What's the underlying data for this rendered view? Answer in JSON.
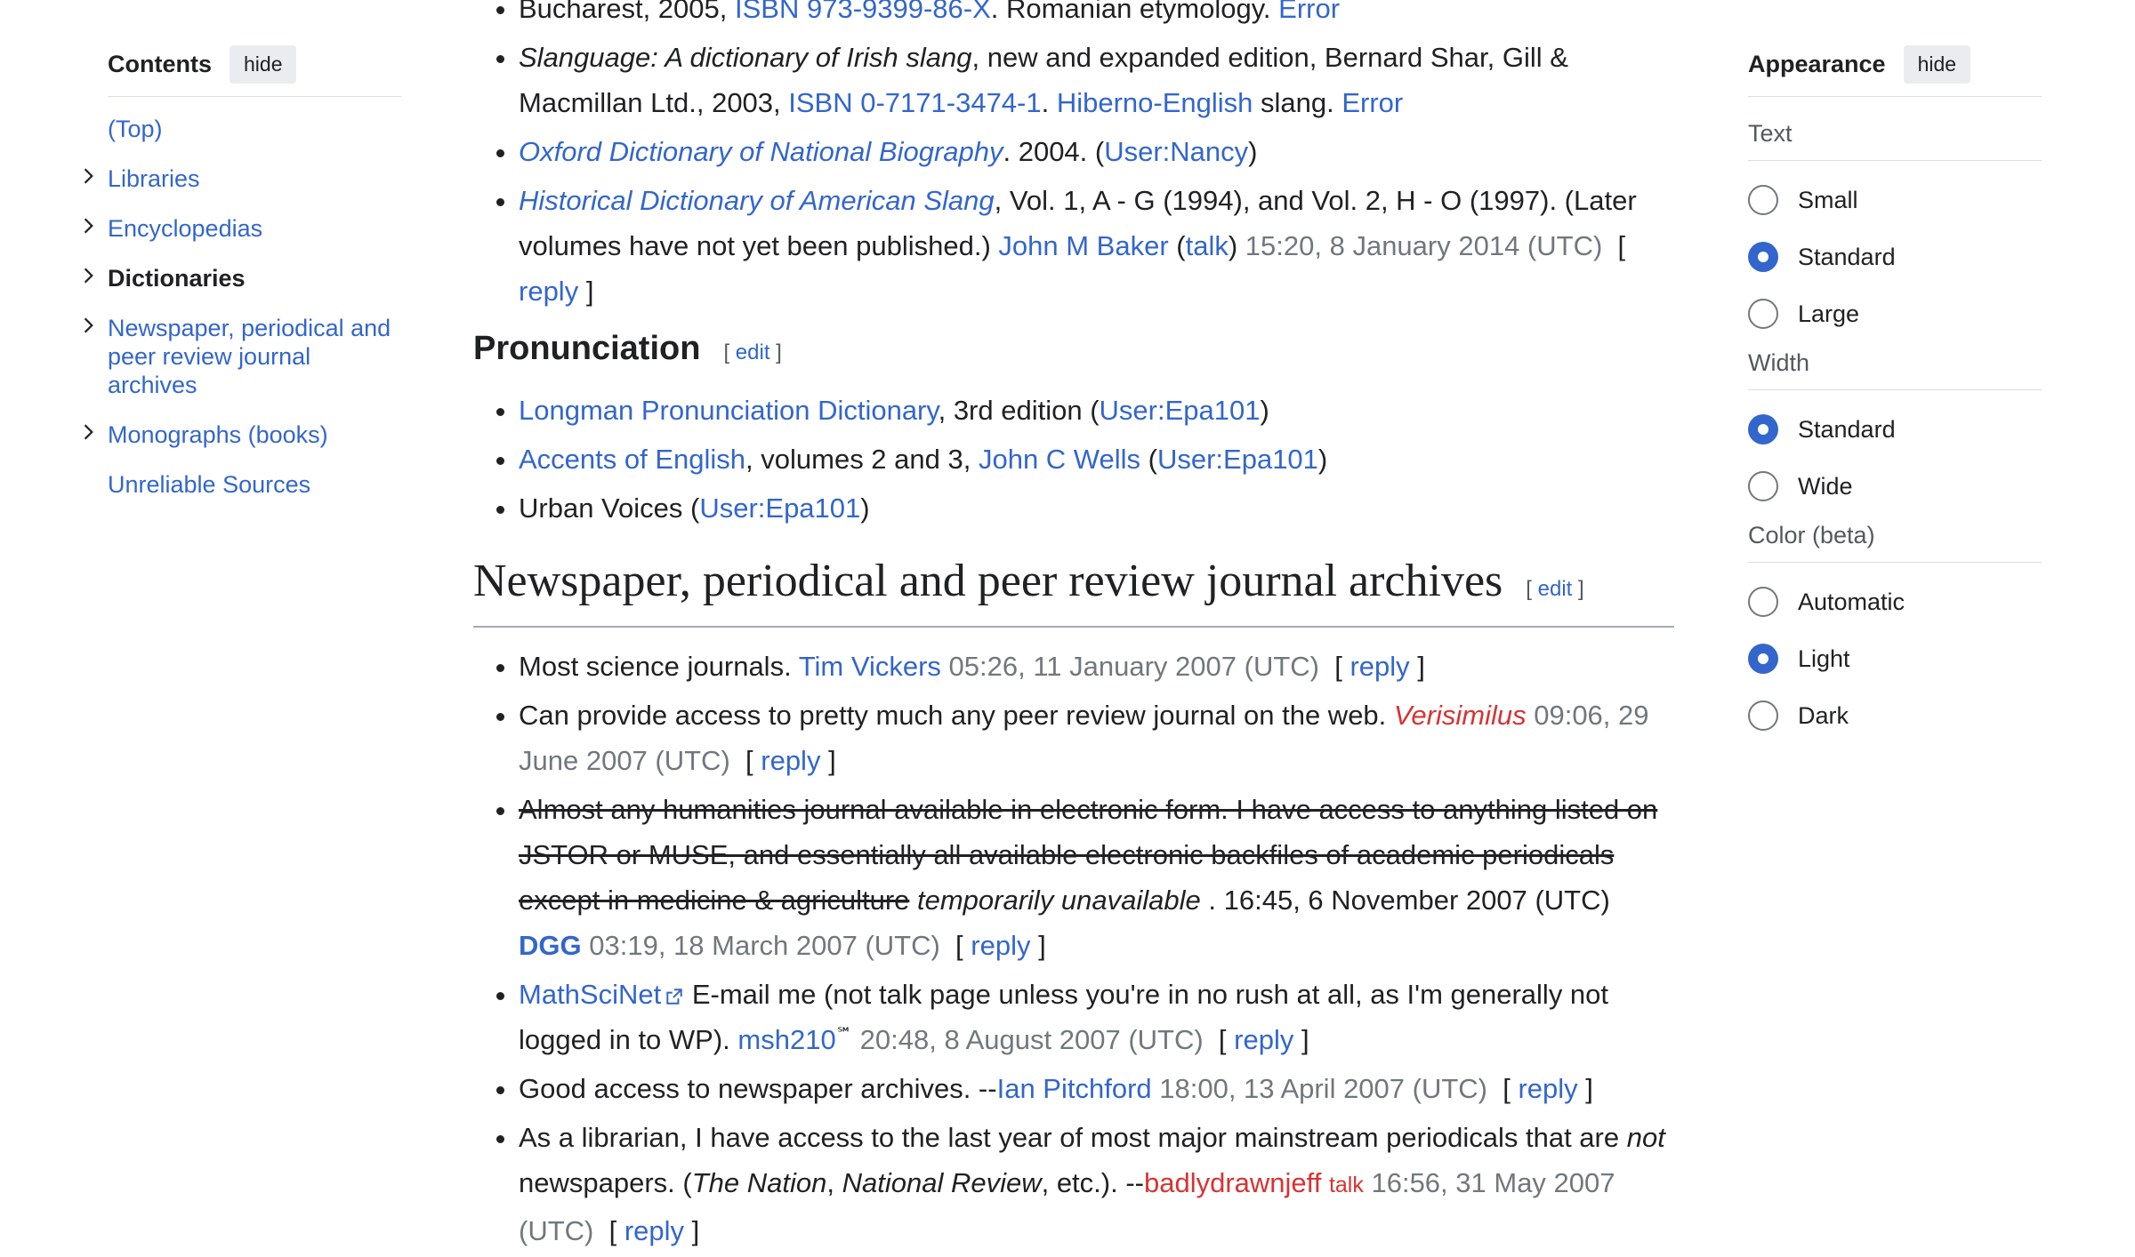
{
  "toc": {
    "title": "Contents",
    "hide_label": "hide",
    "items": [
      {
        "label": "(Top)",
        "chevron": false,
        "active": false
      },
      {
        "label": "Libraries",
        "chevron": true,
        "active": false
      },
      {
        "label": "Encyclopedias",
        "chevron": true,
        "active": false
      },
      {
        "label": "Dictionaries",
        "chevron": true,
        "active": true
      },
      {
        "label": "Newspaper, periodical and peer review journal archives",
        "chevron": true,
        "active": false
      },
      {
        "label": "Monographs (books)",
        "chevron": true,
        "active": false
      },
      {
        "label": "Unreliable Sources",
        "chevron": false,
        "active": false
      }
    ]
  },
  "appearance": {
    "title": "Appearance",
    "hide_label": "hide",
    "text_label": "Text",
    "text_options": [
      {
        "label": "Small",
        "selected": false
      },
      {
        "label": "Standard",
        "selected": true
      },
      {
        "label": "Large",
        "selected": false
      }
    ],
    "width_label": "Width",
    "width_options": [
      {
        "label": "Standard",
        "selected": true
      },
      {
        "label": "Wide",
        "selected": false
      }
    ],
    "color_label": "Color (beta)",
    "color_options": [
      {
        "label": "Automatic",
        "selected": false
      },
      {
        "label": "Light",
        "selected": true
      },
      {
        "label": "Dark",
        "selected": false
      }
    ]
  },
  "content": {
    "top": {
      "line0_prefix": "Bucharest, 2005, ",
      "line0_isbn": "ISBN 973-9399-86-X",
      "line0_mid": ". Romanian etymology. ",
      "line0_error": "Error",
      "slang_title": "Slanguage: A dictionary of Irish slang",
      "slang_rest": ", new and expanded edition, Bernard Shar, Gill & Macmillan Ltd., 2003, ",
      "slang_isbn": "ISBN 0-7171-3474-1",
      "slang_dot": ". ",
      "slang_hib": "Hiberno-English",
      "slang_tail": " slang. ",
      "slang_error": "Error",
      "odnb_title": "Oxford Dictionary of National Biography",
      "odnb_rest": ". 2004. (",
      "odnb_user": "User:Nancy",
      "odnb_close": ")",
      "hdas_title": "Historical Dictionary of American Slang",
      "hdas_rest": ", Vol. 1, A - G (1994), and Vol. 2, H - O (1997). (Later volumes have not yet been published.) ",
      "hdas_user": "John M Baker",
      "hdas_open": " (",
      "hdas_talk": "talk",
      "hdas_close": ") ",
      "hdas_time": "15:20, 8 January 2014 (UTC)",
      "reply": "reply"
    },
    "pron": {
      "heading": "Pronunciation",
      "edit": "edit",
      "i1_link": "Longman Pronunciation Dictionary",
      "i1_rest": ", 3rd edition (",
      "i1_user": "User:Epa101",
      "i1_close": ")",
      "i2_link": "Accents of English",
      "i2_rest": ", volumes 2 and 3, ",
      "i2_author": "John C Wells",
      "i2_open": " (",
      "i2_user": "User:Epa101",
      "i2_close": ")",
      "i3_text": "Urban Voices (",
      "i3_user": "User:Epa101",
      "i3_close": ")"
    },
    "news": {
      "heading": "Newspaper, periodical and peer review journal archives",
      "edit": "edit",
      "reply": "reply",
      "i1_text": "Most science journals. ",
      "i1_user": "Tim Vickers",
      "i1_time": " 05:26, 11 January 2007 (UTC)",
      "i2_text": "Can provide access to pretty much any peer review journal on the web. ",
      "i2_user": "Verisimilus",
      "i2_time": " 09:06, 29 June 2007 (UTC)",
      "i3_strike": "Almost any humanities journal available in electronic form. I have access to anything listed on JSTOR or MUSE, and essentially all available electronic backfiles of academic periodicals except in medicine & agriculture",
      "i3_italic": " temporarily unavailable",
      "i3_after": " . 16:45, 6 November 2007 (UTC) ",
      "i3_user": "DGG",
      "i3_time": " 03:19, 18 March 2007 (UTC)",
      "i4_link": "MathSciNet",
      "i4_text": " E-mail me (not talk page unless you're in no rush at all, as I'm generally not logged in to WP). ",
      "i4_user": "msh210",
      "i4_sup": "℠",
      "i4_time": " 20:48, 8 August 2007 (UTC)",
      "i5_text": "Good access to newspaper archives. --",
      "i5_user": "Ian Pitchford",
      "i5_time": " 18:00, 13 April 2007 (UTC)",
      "i6_text1": "As a librarian, I have access to the last year of most major mainstream periodicals that are ",
      "i6_not": "not",
      "i6_text2": " newspapers. (",
      "i6_nation": "The Nation",
      "i6_comma": ", ",
      "i6_nr": "National Review",
      "i6_text3": ", etc.). --",
      "i6_user": "badlydrawnjeff",
      "i6_talk": "talk",
      "i6_time": " 16:56, 31 May 2007 (UTC)"
    }
  }
}
